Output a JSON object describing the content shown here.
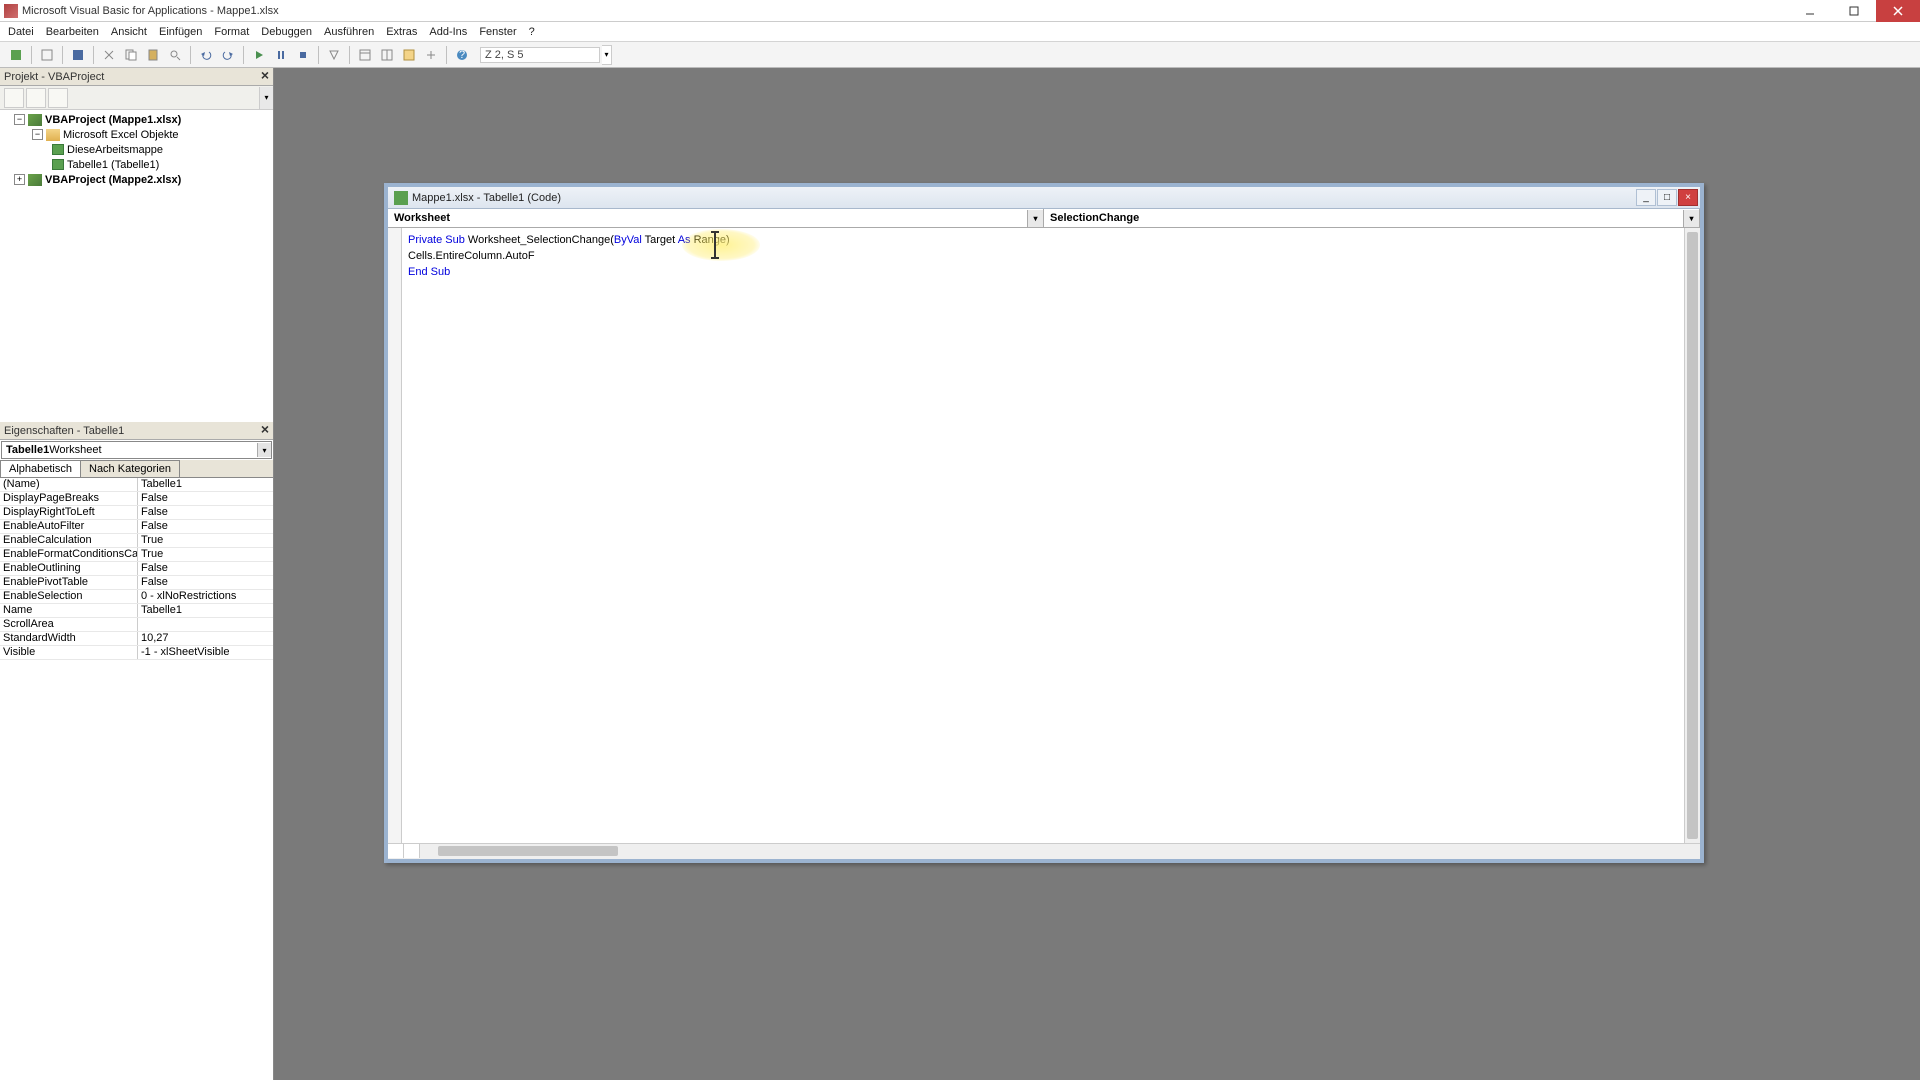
{
  "titlebar": {
    "title": "Microsoft Visual Basic for Applications - Mappe1.xlsx"
  },
  "menu": {
    "items": [
      "Datei",
      "Bearbeiten",
      "Ansicht",
      "Einfügen",
      "Format",
      "Debuggen",
      "Ausführen",
      "Extras",
      "Add-Ins",
      "Fenster",
      "?"
    ]
  },
  "toolbar": {
    "cursor_pos": "Z 2, S 5"
  },
  "project_panel": {
    "title": "Projekt - VBAProject"
  },
  "tree": {
    "proj1": "VBAProject (Mappe1.xlsx)",
    "folder1": "Microsoft Excel Objekte",
    "sheet1": "DieseArbeitsmappe",
    "sheet2": "Tabelle1 (Tabelle1)",
    "proj2": "VBAProject (Mappe2.xlsx)"
  },
  "props_panel": {
    "title": "Eigenschaften - Tabelle1",
    "combo_bold": "Tabelle1",
    "combo_type": " Worksheet",
    "tab1": "Alphabetisch",
    "tab2": "Nach Kategorien",
    "rows": [
      {
        "k": "(Name)",
        "v": "Tabelle1"
      },
      {
        "k": "DisplayPageBreaks",
        "v": "False"
      },
      {
        "k": "DisplayRightToLeft",
        "v": "False"
      },
      {
        "k": "EnableAutoFilter",
        "v": "False"
      },
      {
        "k": "EnableCalculation",
        "v": "True"
      },
      {
        "k": "EnableFormatConditionsCalc",
        "v": "True"
      },
      {
        "k": "EnableOutlining",
        "v": "False"
      },
      {
        "k": "EnablePivotTable",
        "v": "False"
      },
      {
        "k": "EnableSelection",
        "v": "0 - xlNoRestrictions"
      },
      {
        "k": "Name",
        "v": "Tabelle1"
      },
      {
        "k": "ScrollArea",
        "v": ""
      },
      {
        "k": "StandardWidth",
        "v": "10,27"
      },
      {
        "k": "Visible",
        "v": "-1 - xlSheetVisible"
      }
    ]
  },
  "codewin": {
    "title": "Mappe1.xlsx - Tabelle1 (Code)",
    "dd_object": "Worksheet",
    "dd_proc": "SelectionChange",
    "code": {
      "l1_kw1": "Private Sub",
      "l1_rest": " Worksheet_SelectionChange(",
      "l1_kw2": "ByVal",
      "l1_mid": " Target ",
      "l1_kw3": "As",
      "l1_end": " Range)",
      "l2": "Cells.EntireColumn.AutoF",
      "l3": "End Sub"
    }
  }
}
